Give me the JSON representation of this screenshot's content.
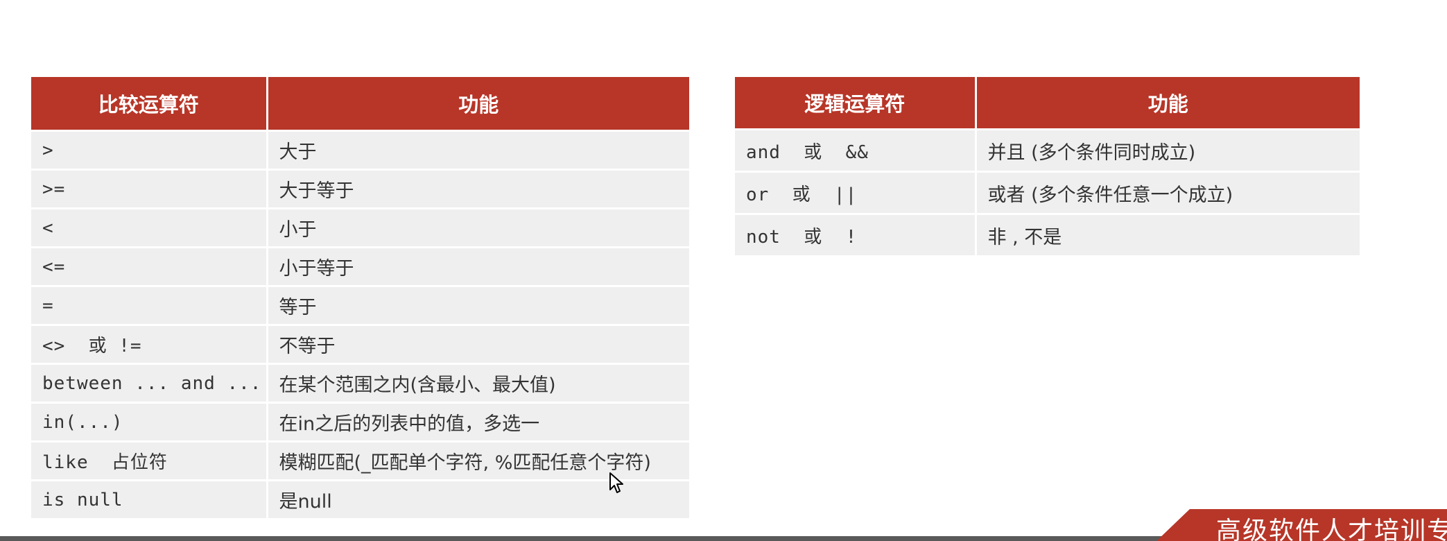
{
  "comparison_table": {
    "headers": [
      "比较运算符",
      "功能"
    ],
    "rows": [
      {
        "op": ">",
        "desc": "大于"
      },
      {
        "op": ">=",
        "desc": "大于等于"
      },
      {
        "op": "<",
        "desc": "小于"
      },
      {
        "op": "<=",
        "desc": "小于等于"
      },
      {
        "op": "=",
        "desc": "等于"
      },
      {
        "op": "<>  或 !=",
        "desc": "不等于"
      },
      {
        "op": "between ... and ...",
        "desc": "在某个范围之内(含最小、最大值)"
      },
      {
        "op": "in(...)",
        "desc": "在in之后的列表中的值，多选一"
      },
      {
        "op": "like  占位符",
        "desc": "模糊匹配(_匹配单个字符, %匹配任意个字符)"
      },
      {
        "op": "is null",
        "desc": "是null"
      }
    ]
  },
  "logic_table": {
    "headers": [
      "逻辑运算符",
      "功能"
    ],
    "rows": [
      {
        "op": "and  或  &&",
        "desc": "并且 (多个条件同时成立)"
      },
      {
        "op": "or  或  ||",
        "desc": "或者 (多个条件任意一个成立)"
      },
      {
        "op": "not  或  !",
        "desc": "非 , 不是"
      }
    ]
  },
  "banner": {
    "text": "高级软件人才培训专家"
  },
  "colors": {
    "header_bg": "#b73628",
    "row_bg": "#efefef",
    "text": "#333333"
  },
  "icons": {
    "cursor": "mouse-pointer-icon"
  }
}
